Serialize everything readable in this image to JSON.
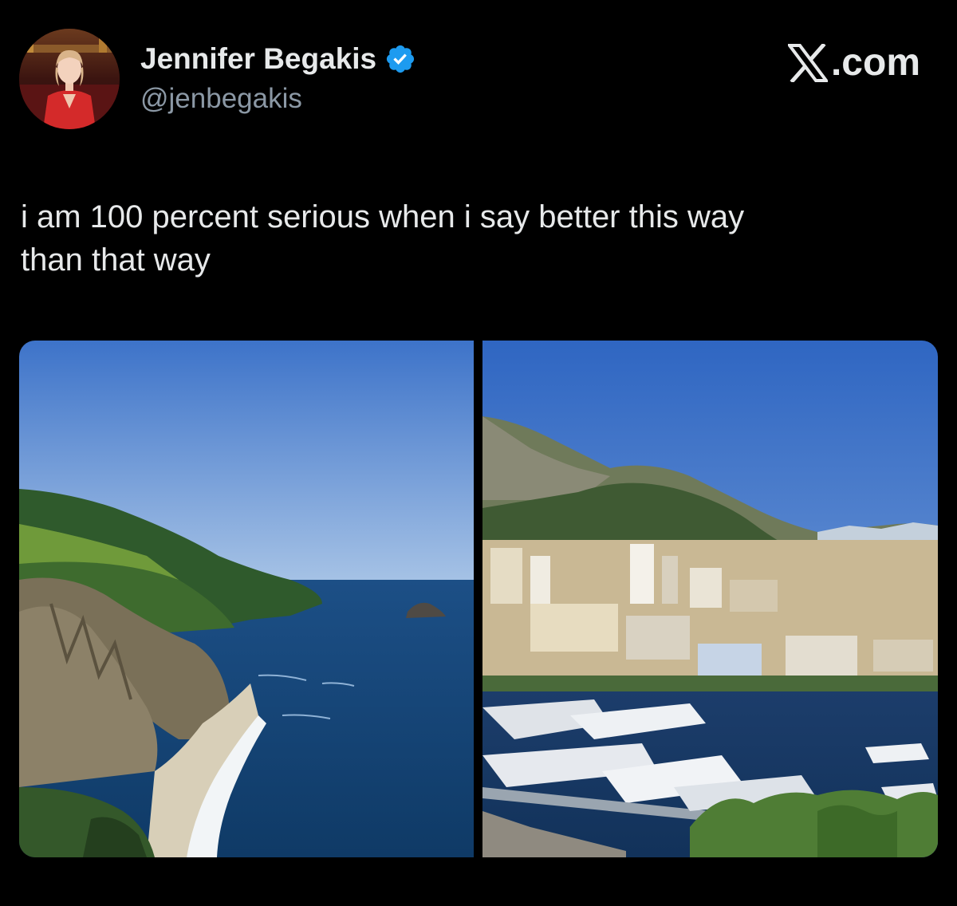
{
  "author": {
    "display_name": "Jennifer Begakis",
    "handle": "@jenbegakis",
    "verified": true,
    "avatar_icon": "profile-avatar"
  },
  "brand": {
    "icon": "x-logo-icon",
    "suffix": ".com"
  },
  "tweet": {
    "text_lines": [
      "i am 100 percent serious when i say better this way",
      "than that way"
    ]
  },
  "media": {
    "count": 2,
    "items": [
      {
        "icon": "coastline-photo"
      },
      {
        "icon": "harbor-city-photo"
      }
    ]
  },
  "colors": {
    "background": "#000000",
    "text_primary": "#e7e9ea",
    "text_secondary": "#8b98a5",
    "verified_badge": "#1d9bf0"
  }
}
